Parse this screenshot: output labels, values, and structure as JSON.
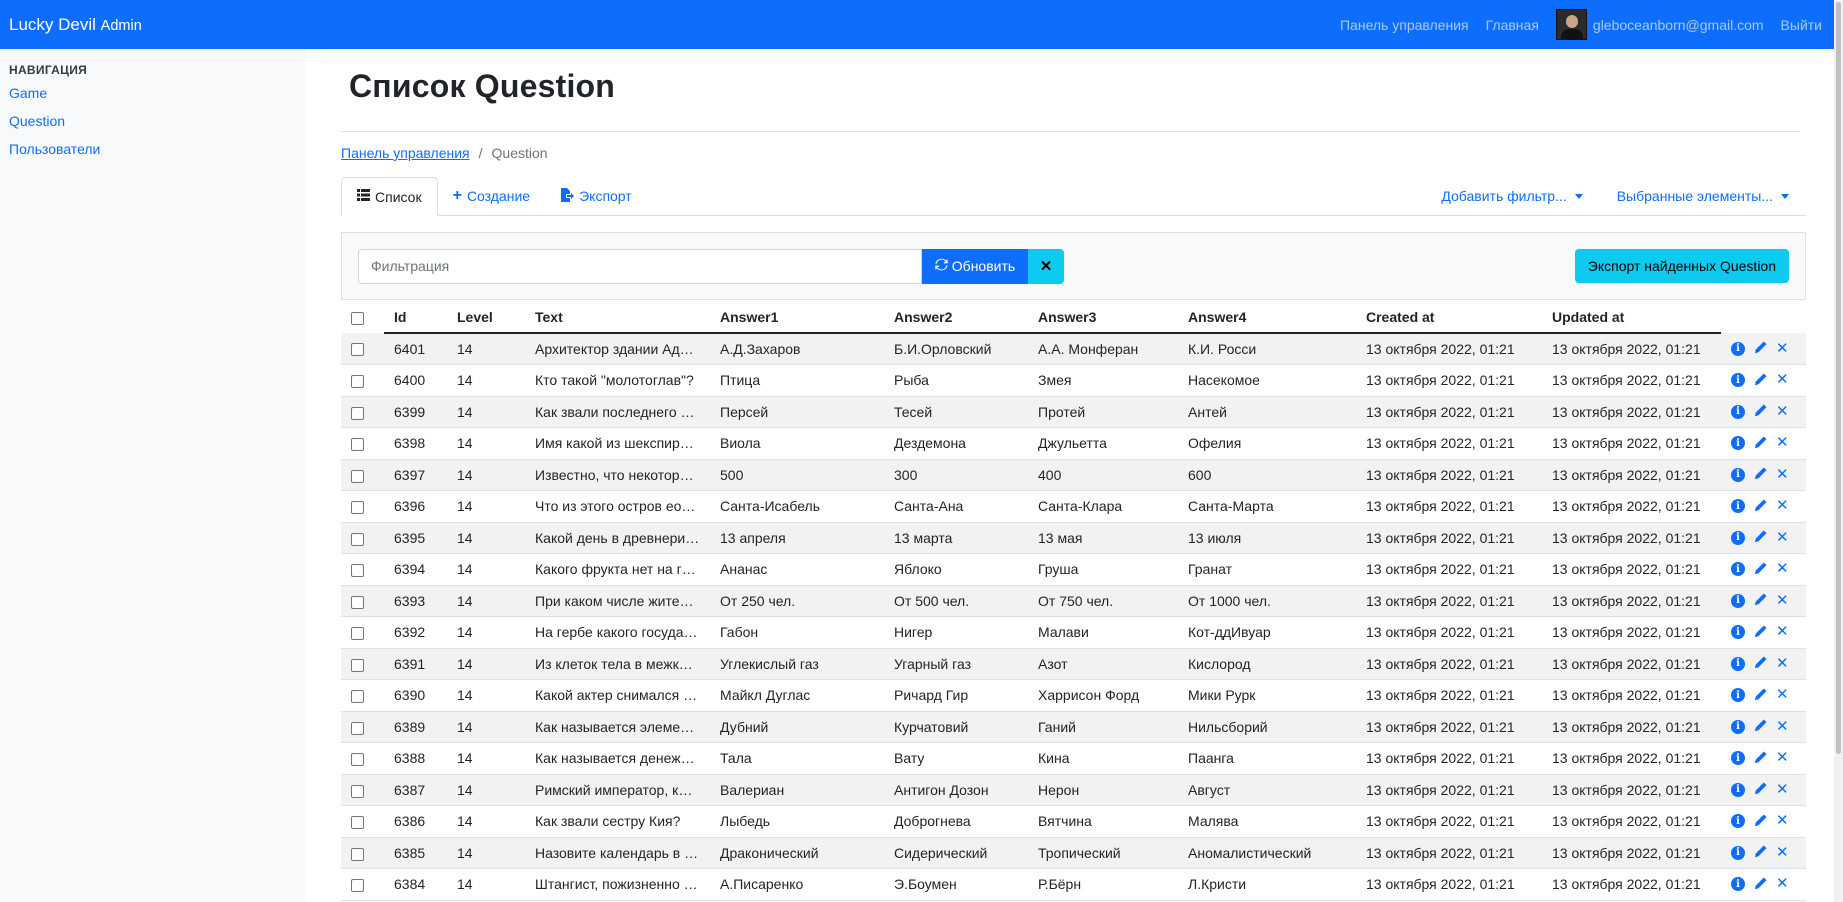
{
  "navbar": {
    "brand": "Lucky Devil",
    "brand_suffix": "Admin",
    "links": {
      "dashboard": "Панель управления",
      "home": "Главная",
      "user_email": "gleboceanborn@gmail.com",
      "logout": "Выйти"
    }
  },
  "sidebar": {
    "heading": "НАВИГАЦИЯ",
    "items": [
      {
        "label": "Game"
      },
      {
        "label": "Question"
      },
      {
        "label": "Пользователи"
      }
    ]
  },
  "page": {
    "title": "Список Question"
  },
  "breadcrumb": {
    "parent": "Панель управления",
    "separator": "/",
    "current": "Question"
  },
  "tabs": {
    "list": "Список",
    "create": "Создание",
    "export": "Экспорт",
    "add_filter": "Добавить фильтр...",
    "selected": "Выбранные элементы..."
  },
  "filter": {
    "placeholder": "Фильтрация",
    "refresh_label": "Обновить",
    "clear_label": "✕",
    "export_label": "Экспорт найденных Question"
  },
  "icons": {
    "list": "list-icon",
    "plus": "plus-icon",
    "export": "export-file-icon",
    "refresh": "refresh-icon",
    "info": "info-circle-icon",
    "edit": "pencil-icon",
    "delete": "close-icon"
  },
  "colors": {
    "primary": "#0d6efd",
    "info": "#0dcaf0",
    "stripe": "#f2f2f2"
  },
  "table": {
    "columns": [
      "Id",
      "Level",
      "Text",
      "Answer1",
      "Answer2",
      "Answer3",
      "Answer4",
      "Created at",
      "Updated at"
    ],
    "rows": [
      {
        "id": "6401",
        "level": "14",
        "text": "Архитектор здании Ад…",
        "a1": "А.Д.Захаров",
        "a2": "Б.И.Орловский",
        "a3": "А.А. Монферан",
        "a4": "К.И. Росси",
        "created": "13 октября 2022, 01:21",
        "updated": "13 октября 2022, 01:21"
      },
      {
        "id": "6400",
        "level": "14",
        "text": "Кто такой \"молотоглав\"?",
        "a1": "Птица",
        "a2": "Рыба",
        "a3": "Змея",
        "a4": "Насекомое",
        "created": "13 октября 2022, 01:21",
        "updated": "13 октября 2022, 01:21"
      },
      {
        "id": "6399",
        "level": "14",
        "text": "Как звали последнего …",
        "a1": "Персей",
        "a2": "Тесей",
        "a3": "Протей",
        "a4": "Антей",
        "created": "13 октября 2022, 01:21",
        "updated": "13 октября 2022, 01:21"
      },
      {
        "id": "6398",
        "level": "14",
        "text": "Имя какой из шекспир…",
        "a1": "Виола",
        "a2": "Дездемона",
        "a3": "Джульетта",
        "a4": "Офелия",
        "created": "13 октября 2022, 01:21",
        "updated": "13 октября 2022, 01:21"
      },
      {
        "id": "6397",
        "level": "14",
        "text": "Известно, что некотор…",
        "a1": "500",
        "a2": "300",
        "a3": "400",
        "a4": "600",
        "created": "13 октября 2022, 01:21",
        "updated": "13 октября 2022, 01:21"
      },
      {
        "id": "6396",
        "level": "14",
        "text": "Что из этого остров еос…",
        "a1": "Санта-Исабель",
        "a2": "Санта-Ана",
        "a3": "Санта-Клара",
        "a4": "Санта-Марта",
        "created": "13 октября 2022, 01:21",
        "updated": "13 октября 2022, 01:21"
      },
      {
        "id": "6395",
        "level": "14",
        "text": "Какой день в древнери…",
        "a1": "13 апреля",
        "a2": "13 марта",
        "a3": "13 мая",
        "a4": "13 июля",
        "created": "13 октября 2022, 01:21",
        "updated": "13 октября 2022, 01:21"
      },
      {
        "id": "6394",
        "level": "14",
        "text": "Какого фрукта нет на г…",
        "a1": "Ананас",
        "a2": "Яблоко",
        "a3": "Груша",
        "a4": "Гранат",
        "created": "13 октября 2022, 01:21",
        "updated": "13 октября 2022, 01:21"
      },
      {
        "id": "6393",
        "level": "14",
        "text": "При каком числе жите…",
        "a1": "От 250 чел.",
        "a2": "От 500 чел.",
        "a3": "От 750 чел.",
        "a4": "От 1000 чел.",
        "created": "13 октября 2022, 01:21",
        "updated": "13 октября 2022, 01:21"
      },
      {
        "id": "6392",
        "level": "14",
        "text": "На гербе какого госуда…",
        "a1": "Габон",
        "a2": "Нигер",
        "a3": "Малави",
        "a4": "Кот-ддИвуар",
        "created": "13 октября 2022, 01:21",
        "updated": "13 октября 2022, 01:21"
      },
      {
        "id": "6391",
        "level": "14",
        "text": "Из клеток тела в межк…",
        "a1": "Углекислый газ",
        "a2": "Угарный газ",
        "a3": "Азот",
        "a4": "Кислород",
        "created": "13 октября 2022, 01:21",
        "updated": "13 октября 2022, 01:21"
      },
      {
        "id": "6390",
        "level": "14",
        "text": "Какой актер снимался …",
        "a1": "Майкл Дуглас",
        "a2": "Ричард Гир",
        "a3": "Харрисон Форд",
        "a4": "Мики Рурк",
        "created": "13 октября 2022, 01:21",
        "updated": "13 октября 2022, 01:21"
      },
      {
        "id": "6389",
        "level": "14",
        "text": "Как называется элемен…",
        "a1": "Дубний",
        "a2": "Курчатовий",
        "a3": "Ганий",
        "a4": "Нильсборий",
        "created": "13 октября 2022, 01:21",
        "updated": "13 октября 2022, 01:21"
      },
      {
        "id": "6388",
        "level": "14",
        "text": "Как называется денеж…",
        "a1": "Тала",
        "a2": "Вату",
        "a3": "Кина",
        "a4": "Паанга",
        "created": "13 октября 2022, 01:21",
        "updated": "13 октября 2022, 01:21"
      },
      {
        "id": "6387",
        "level": "14",
        "text": "Римский император, ко…",
        "a1": "Валериан",
        "a2": "Антигон Дозон",
        "a3": "Нерон",
        "a4": "Август",
        "created": "13 октября 2022, 01:21",
        "updated": "13 октября 2022, 01:21"
      },
      {
        "id": "6386",
        "level": "14",
        "text": "Как звали сестру Кия?",
        "a1": "Лыбедь",
        "a2": "Доброгнева",
        "a3": "Вятчина",
        "a4": "Малява",
        "created": "13 октября 2022, 01:21",
        "updated": "13 октября 2022, 01:21"
      },
      {
        "id": "6385",
        "level": "14",
        "text": "Назовите календарь в …",
        "a1": "Драконический",
        "a2": "Сидерический",
        "a3": "Тропический",
        "a4": "Аномалистический",
        "created": "13 октября 2022, 01:21",
        "updated": "13 октября 2022, 01:21"
      },
      {
        "id": "6384",
        "level": "14",
        "text": "Штангист, пожизненно …",
        "a1": "А.Писаренко",
        "a2": "Э.Боумен",
        "a3": "Р.Бёрн",
        "a4": "Л.Кристи",
        "created": "13 октября 2022, 01:21",
        "updated": "13 октября 2022, 01:21"
      }
    ]
  }
}
